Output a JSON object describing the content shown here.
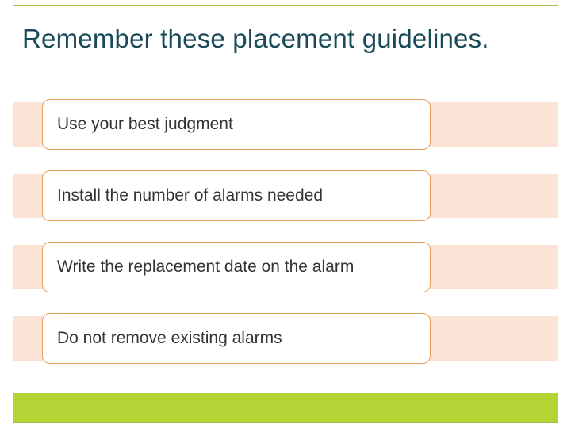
{
  "title": "Remember these placement guidelines.",
  "items": [
    {
      "text": "Use your best judgment"
    },
    {
      "text": "Install the number of alarms needed"
    },
    {
      "text": "Write the replacement date on the alarm"
    },
    {
      "text": "Do not remove existing alarms"
    }
  ]
}
